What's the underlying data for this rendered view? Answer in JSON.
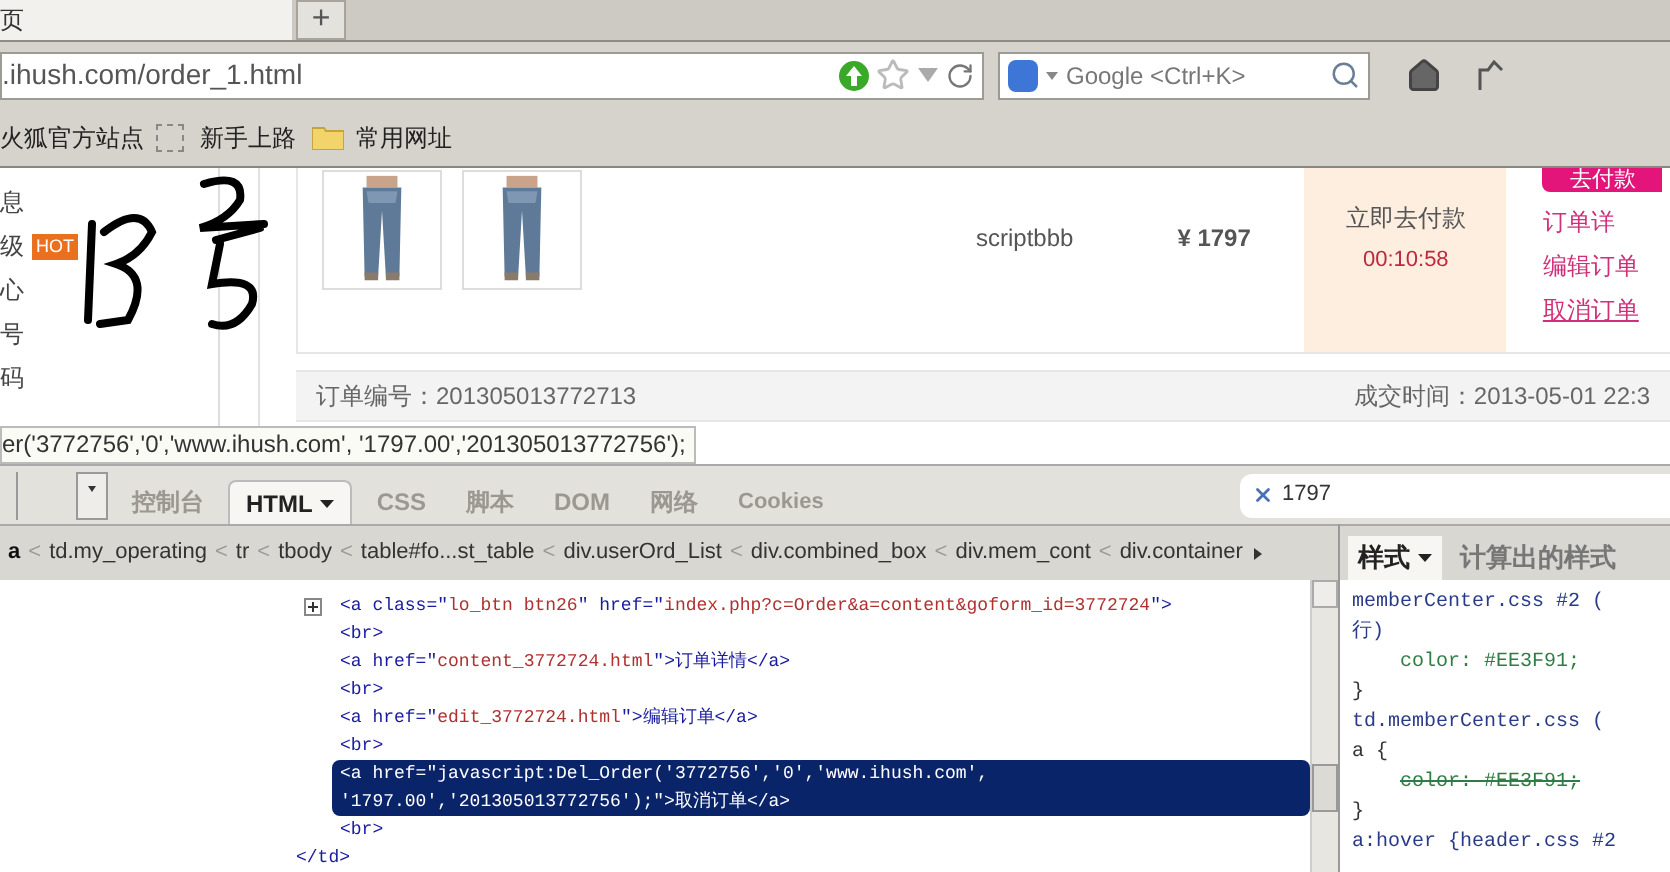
{
  "browser": {
    "tabs": [
      {
        "label": "页",
        "selected": true
      }
    ],
    "new_tab": "+",
    "url": ".ihush.com/order_1.html",
    "search": {
      "placeholder": "Google <Ctrl+K>"
    },
    "bookmarks": [
      {
        "label": "火狐官方站点",
        "kind": "link"
      },
      {
        "label": "新手上路",
        "kind": "link"
      },
      {
        "label": "常用网址",
        "kind": "folder"
      }
    ]
  },
  "sidebar": {
    "items": [
      {
        "label": "息"
      },
      {
        "label": "级",
        "badge": "HOT"
      },
      {
        "label": "心"
      },
      {
        "label": "号"
      },
      {
        "label": "码"
      }
    ]
  },
  "order": {
    "product": "scriptbbb",
    "price": "¥ 1797",
    "pay_label": "立即去付款",
    "countdown": "00:10:58",
    "pay_button": "去付款",
    "actions": [
      {
        "label": "订单详",
        "underlined": false
      },
      {
        "label": "编辑订单",
        "underlined": false
      },
      {
        "label": "取消订单",
        "underlined": true
      }
    ],
    "number": "订单编号：201305013772713",
    "time": "成交时间：2013-05-01 22:3"
  },
  "status_bar": "er('3772756','0','www.ihush.com', '1797.00','201305013772756');",
  "devtools": {
    "tabs": [
      {
        "label": "控制台",
        "selected": false,
        "dropdown": false
      },
      {
        "label": "HTML",
        "selected": true,
        "dropdown": true
      },
      {
        "label": "CSS",
        "selected": false,
        "dropdown": false
      },
      {
        "label": "脚本",
        "selected": false,
        "dropdown": false
      },
      {
        "label": "DOM",
        "selected": false,
        "dropdown": false
      },
      {
        "label": "网络",
        "selected": false,
        "dropdown": false
      },
      {
        "label": "Cookies",
        "selected": false,
        "dropdown": false
      }
    ],
    "search": "1797",
    "breadcrumbs": [
      {
        "label": "a",
        "selected": true
      },
      {
        "label": "td.my_operating",
        "selected": false
      },
      {
        "label": "tr",
        "selected": false
      },
      {
        "label": "tbody",
        "selected": false
      },
      {
        "label": "table#fo...st_table",
        "selected": false
      },
      {
        "label": "div.userOrd_List",
        "selected": false
      },
      {
        "label": "div.combined_box",
        "selected": false
      },
      {
        "label": "div.mem_cont",
        "selected": false
      },
      {
        "label": "div.container",
        "selected": false
      }
    ],
    "breadcrumb_separator": "<",
    "html_tree": {
      "closing": "</td>",
      "children": [
        {
          "text": "<a class=\"lo_btn btn26\" href=\"index.php?c=Order&a=content&goform_id=3772724\">",
          "selected": false,
          "expandable": true
        },
        {
          "text": "<br>",
          "selected": false,
          "expandable": false
        },
        {
          "text": "<a href=\"content_3772724.html\">订单详情</a>",
          "selected": false,
          "expandable": false
        },
        {
          "text": "<br>",
          "selected": false,
          "expandable": false
        },
        {
          "text": "<a href=\"edit_3772724.html\">编辑订单</a>",
          "selected": false,
          "expandable": false
        },
        {
          "text": "<br>",
          "selected": false,
          "expandable": false
        },
        {
          "text": "<a href=\"javascript:Del_Order('3772756','0','www.ihush.com',\n'1797.00','201305013772756');\">取消订单</a>",
          "selected": true,
          "expandable": false
        },
        {
          "text": "<br>",
          "selected": false,
          "expandable": false
        }
      ]
    },
    "side_tabs": [
      {
        "label": "样式",
        "selected": true,
        "dropdown": true
      },
      {
        "label": "计算出的样式",
        "selected": false,
        "dropdown": false
      }
    ],
    "css_rules": [
      {
        "text": "memberCenter.css #2 (",
        "kind": "source"
      },
      {
        "text": "行)",
        "kind": "source"
      },
      {
        "text": "color: #EE3F91;",
        "kind": "prop"
      },
      {
        "text": "}",
        "kind": "plain"
      },
      {
        "text": "td.memberCenter.css (",
        "kind": "source"
      },
      {
        "text": "a {",
        "kind": "plain"
      },
      {
        "text": "color: #EE3F91;",
        "kind": "overridden"
      },
      {
        "text": "}",
        "kind": "plain"
      },
      {
        "text": "a:hover {header.css #2",
        "kind": "source"
      }
    ]
  }
}
